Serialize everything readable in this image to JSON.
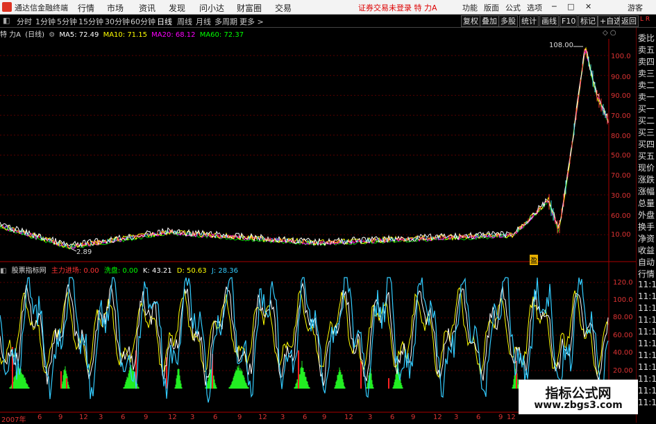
{
  "menubar": {
    "app_title": "通达信金融终端",
    "items": [
      "行情",
      "市场",
      "资讯",
      "发现",
      "问小达",
      "财富圈",
      "交易"
    ],
    "login_status": "证券交易未登录  特 力A",
    "right_items": [
      "功能",
      "版面",
      "公式",
      "选项"
    ],
    "user": "游客"
  },
  "toolbar": {
    "periods": [
      "分时",
      "1分钟",
      "5分钟",
      "15分钟",
      "30分钟",
      "60分钟",
      "日线",
      "周线",
      "月线",
      "多周期",
      "更多 >"
    ],
    "selected": "日线",
    "right_buttons": [
      "复权",
      "叠加",
      "多股",
      "统计",
      "画线",
      "F10",
      "标记",
      "+自选",
      "返回"
    ]
  },
  "sidebar": {
    "items": [
      "委比",
      "卖五",
      "卖四",
      "卖三",
      "卖二",
      "卖一",
      "买一",
      "买二",
      "买三",
      "买四",
      "买五",
      "现价",
      "涨跌",
      "涨幅",
      "总量",
      "外盘",
      "换手",
      "净资",
      "收益",
      "自动",
      "行情",
      "11:1",
      "11:1",
      "11:1",
      "11:1",
      "11:1",
      "11:1",
      "11:1",
      "11:1",
      "11:1",
      "11:1",
      "11:1"
    ]
  },
  "main_chart": {
    "stock": "特 力A",
    "period_label": "(日线)",
    "ma": [
      {
        "label": "MA5: 72.49",
        "color": "#ffffff"
      },
      {
        "label": "MA10: 71.15",
        "color": "#ffff00"
      },
      {
        "label": "MA20: 68.12",
        "color": "#ff00ff"
      },
      {
        "label": "MA60: 72.37",
        "color": "#00ff00"
      }
    ],
    "y_ticks": [
      "100.0",
      "90.00",
      "80.00",
      "70.00",
      "60.00",
      "50.00",
      "40.00",
      "30.00",
      "20.00",
      "10.00"
    ],
    "high_label": "108.00",
    "low_label": "2.89",
    "marker": "盈"
  },
  "sub_chart": {
    "name": "股票指标网",
    "indicators": [
      {
        "label": "主力进场: 0.00",
        "color": "#ff3333"
      },
      {
        "label": "洗盘: 0.00",
        "color": "#00ff00"
      },
      {
        "label": "K: 43.21",
        "color": "#ffffff"
      },
      {
        "label": "D: 50.63",
        "color": "#ffff00"
      },
      {
        "label": "J: 28.36",
        "color": "#33ccff"
      }
    ],
    "y_ticks": [
      "120.0",
      "100.0",
      "80.00",
      "60.00",
      "40.00",
      "20.00"
    ]
  },
  "x_axis": [
    "2007年",
    "6",
    "9",
    "12",
    "3",
    "6",
    "9",
    "12",
    "3",
    "6",
    "9",
    "12",
    "3",
    "6",
    "9",
    "12",
    "3",
    "6",
    "9",
    "12",
    "3",
    "6",
    "9",
    "12",
    "3",
    "6",
    "10"
  ],
  "watermark": {
    "line1": "指标公式网",
    "line2": "www.zbgs3.com"
  }
}
